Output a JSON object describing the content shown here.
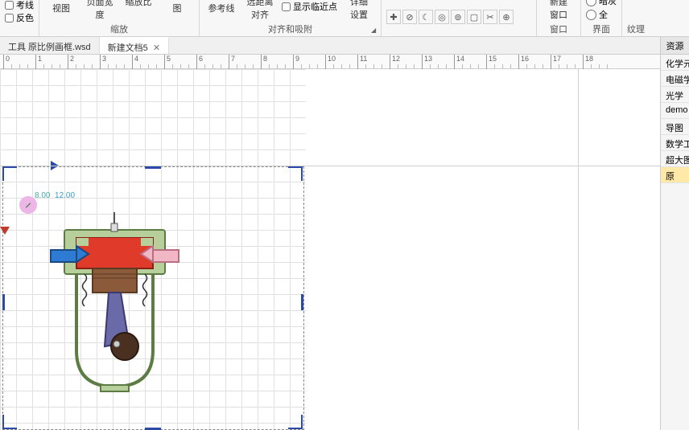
{
  "ribbon": {
    "left_checks": {
      "kxian": "考线",
      "fanse": "反色"
    },
    "zoom": {
      "fit_view": "适合到\n视图",
      "fit_width": "适合到\n页面宽度",
      "ratio": "缩放比",
      "drag_view": "拖动视图",
      "group_label": "缩放"
    },
    "align": {
      "guides": "参考线",
      "far_align": "远距离\n对齐",
      "show_near": "显示临近点",
      "detail": "详细\n设置",
      "group_label": "对齐和吸附"
    },
    "window": {
      "new_window": "新建\n窗口",
      "group_label": "窗口"
    },
    "interface": {
      "dark": "暗灰",
      "other": "全",
      "group_label": "界面"
    },
    "texture": {
      "label": "纹理"
    }
  },
  "tabs": {
    "t1": "工具 原比例画框.wsd",
    "t2": "新建文档5"
  },
  "ruler_ticks": [
    "0",
    "1",
    "2",
    "3",
    "4",
    "5",
    "6",
    "7",
    "8",
    "9",
    "10",
    "11",
    "12",
    "13",
    "14",
    "15",
    "16",
    "17",
    "18"
  ],
  "coord": {
    "a": "8.00",
    "b": "12.00"
  },
  "res": {
    "head": "资源",
    "items": [
      "化学元",
      "电磁学",
      "光学",
      "demo",
      "导图",
      "数学工",
      "超大图",
      "原"
    ]
  }
}
